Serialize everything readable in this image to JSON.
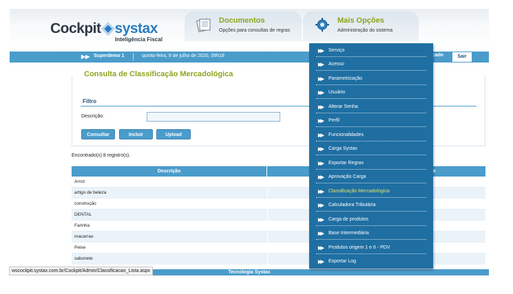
{
  "brand": {
    "name_a": "Cockpit",
    "name_b": "systax",
    "subtitle": "Inteligência Fiscal"
  },
  "header_tabs": [
    {
      "title": "Documentos",
      "subtitle": "Opções para consultas de regras",
      "icon": "document-icon"
    },
    {
      "title": "Mais Opções",
      "subtitle": "Administração do sistema",
      "icon": "gear-icon"
    }
  ],
  "topbar": {
    "arrow": "▶▶",
    "user": "Superdemo 1",
    "date": "quinta-feira, 9 de julho de 2020, 09h18",
    "partial_label": "rcado",
    "logout": "Sair"
  },
  "page": {
    "title": "Consulta de Classificação Mercadológica",
    "filter_title": "Filtro",
    "description_label": "Descrição:",
    "description_value": "",
    "buttons": {
      "consultar": "Consultar",
      "incluir": "Incluir",
      "upload": "Upload"
    },
    "found_text": "Encontrado(s) 8 registro(s)."
  },
  "table": {
    "col_description": "Descrição",
    "col_partial": "ir",
    "rows": [
      "Arroz",
      "artigo de beleza",
      "construção",
      "DENTAL",
      "Farinha",
      "macarrao",
      "Peixe",
      "sabonete"
    ]
  },
  "menu": {
    "items": [
      "Serviço",
      "Acesso",
      "Parametrização",
      "Usuário",
      "Alterar Senha",
      "Perfil",
      "Funcionalidades",
      "Carga Systax",
      "Exportar Regras",
      "Aprovação Carga",
      "Classificação Mercadológica",
      "Calculadora Tributária",
      "Carga de produtos",
      "Base Intermediária",
      "Produtos origem 1 e 6 - PDV",
      "Exportar Log"
    ],
    "active_index": 10,
    "item_arrow": "▶▶"
  },
  "footer": {
    "text": "Tecnologia Systax"
  },
  "status_bar": {
    "url": "wscockpit.systax.com.br/Cockpit/Admin/Classificacao_Lista.aspx"
  },
  "colors": {
    "accent_blue": "#4a9ccb",
    "menu_blue": "#1f6fa3",
    "title_green": "#8ca51e",
    "active_yellow": "#e2e36a"
  }
}
